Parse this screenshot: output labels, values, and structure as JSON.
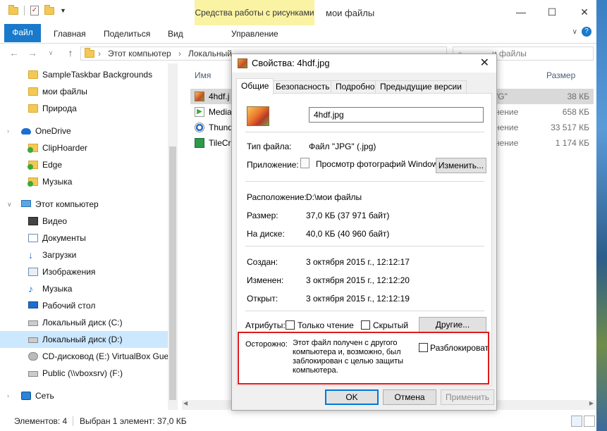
{
  "explorer": {
    "context_tab": "Средства работы с рисунками",
    "window_title": "мои файлы",
    "ribbon_tabs": [
      "Файл",
      "Главная",
      "Поделиться",
      "Вид",
      "Управление"
    ],
    "address": {
      "crumbs": [
        "Этот компьютер",
        "Локальный"
      ]
    },
    "search": {
      "placeholder": "Поиск: мои файлы",
      "visible": "и файлы"
    },
    "nav": [
      {
        "label": "SampleTaskbar Backgrounds",
        "icon": "folder-icon"
      },
      {
        "label": "мои файлы",
        "icon": "folder-icon"
      },
      {
        "label": "Природа",
        "icon": "folder-icon"
      },
      {
        "label": "OneDrive",
        "icon": "onedrive-icon"
      },
      {
        "label": "ClipHoarder",
        "icon": "synced-folder-icon"
      },
      {
        "label": "Edge",
        "icon": "synced-folder-icon"
      },
      {
        "label": "Музыка",
        "icon": "synced-folder-icon"
      },
      {
        "label": "Этот компьютер",
        "icon": "computer-icon"
      },
      {
        "label": "Видео",
        "icon": "video-icon"
      },
      {
        "label": "Документы",
        "icon": "documents-icon"
      },
      {
        "label": "Загрузки",
        "icon": "downloads-icon"
      },
      {
        "label": "Изображения",
        "icon": "pictures-icon"
      },
      {
        "label": "Музыка",
        "icon": "music-icon"
      },
      {
        "label": "Рабочий стол",
        "icon": "desktop-icon"
      },
      {
        "label": "Локальный диск (C:)",
        "icon": "drive-icon"
      },
      {
        "label": "Локальный диск (D:)",
        "icon": "drive-icon"
      },
      {
        "label": "CD-дисковод (E:) VirtualBox Gues",
        "icon": "cd-drive-icon"
      },
      {
        "label": "Public (\\\\vboxsrv) (F:)",
        "icon": "network-drive-icon"
      },
      {
        "label": "Сеть",
        "icon": "network-icon"
      }
    ],
    "columns": {
      "name": "Имя",
      "size": "Размер"
    },
    "files": [
      {
        "name": "4hdf.j",
        "type": "\"G\"",
        "size": "38 КБ"
      },
      {
        "name": "Media",
        "type": "нение",
        "size": "658 КБ"
      },
      {
        "name": "Thund",
        "type": "нение",
        "size": "33 517 КБ"
      },
      {
        "name": "TileCr",
        "type": "нение",
        "size": "1 174 КБ"
      }
    ],
    "status": {
      "items": "Элементов: 4",
      "selected": "Выбран 1 элемент: 37,0 КБ"
    }
  },
  "dialog": {
    "title": "Свойства: 4hdf.jpg",
    "tabs": [
      "Общие",
      "Безопасность",
      "Подробно",
      "Предыдущие версии"
    ],
    "filename": "4hdf.jpg",
    "type_label": "Тип файла:",
    "type_value": "Файл \"JPG\" (.jpg)",
    "app_label": "Приложение:",
    "app_value": "Просмотр фотографий Windows",
    "change_button": "Изменить...",
    "location_label": "Расположение:",
    "location_value": "D:\\мои файлы",
    "size_label": "Размер:",
    "size_value": "37,0 КБ (37 971 байт)",
    "ondisk_label": "На диске:",
    "ondisk_value": "40,0 КБ (40 960 байт)",
    "created_label": "Создан:",
    "created_value": "3 октября 2015 г., 12:12:17",
    "modified_label": "Изменен:",
    "modified_value": "3 октября 2015 г., 12:12:20",
    "opened_label": "Открыт:",
    "opened_value": "3 октября 2015 г., 12:12:19",
    "attributes_label": "Атрибуты:",
    "readonly_label": "Только чтение",
    "hidden_label": "Скрытый",
    "other_button": "Другие...",
    "warning_label": "Осторожно:",
    "warning_text": "Этот файл получен с другого компьютера и, возможно, был заблокирован с целью защиты компьютера.",
    "unblock_label": "Разблокировать",
    "ok_button": "OK",
    "cancel_button": "Отмена",
    "apply_button": "Применить"
  },
  "colors": {
    "accent": "#1979ca",
    "warning_border": "#e01b1b",
    "selection": "#cce8ff"
  }
}
